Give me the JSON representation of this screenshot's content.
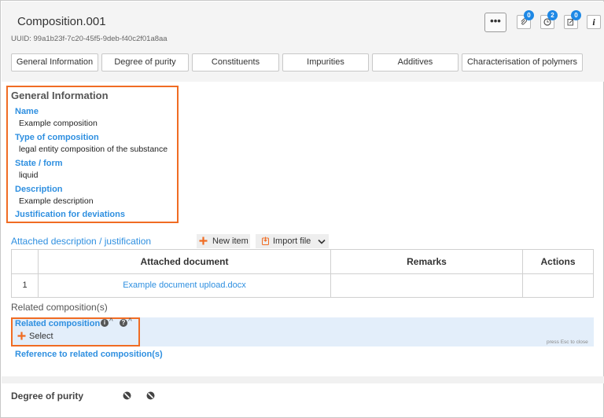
{
  "header": {
    "title": "Composition.001",
    "uuid": "UUID: 99a1b23f-7c20-45f5-9deb-f40c2f01a8aa",
    "more_label": "•••",
    "attachments_count": "0",
    "history_count": "2",
    "notes_count": "0",
    "info_label": "i"
  },
  "tabs": [
    "General Information",
    "Degree of purity",
    "Constituents",
    "Impurities",
    "Additives",
    "Characterisation of polymers"
  ],
  "general_info": {
    "heading": "General Information",
    "fields": [
      {
        "label": "Name",
        "value": "Example composition"
      },
      {
        "label": "Type of composition",
        "value": "legal entity composition of the substance"
      },
      {
        "label": "State / form",
        "value": "liquid"
      },
      {
        "label": "Description",
        "value": "Example description"
      },
      {
        "label": "Justification for deviations",
        "value": ""
      }
    ]
  },
  "attached": {
    "title": "Attached description / justification",
    "new_item_label": "New item",
    "import_label": "Import file",
    "columns": [
      "",
      "Attached document",
      "Remarks",
      "Actions"
    ],
    "rows": [
      {
        "index": "1",
        "document": "Example document upload.docx",
        "remarks": "",
        "actions": ""
      }
    ]
  },
  "related": {
    "section_label": "Related composition(s)",
    "field_label": "Related composition",
    "select_label": "Select",
    "esc_hint": "press Esc to close",
    "reference_link": "Reference to related composition(s)"
  },
  "degree_of_purity": {
    "label": "Degree of purity"
  },
  "colors": {
    "accent_blue": "#2e8fe0",
    "highlight_orange": "#f06c23",
    "badge_blue": "#1e88e5"
  }
}
